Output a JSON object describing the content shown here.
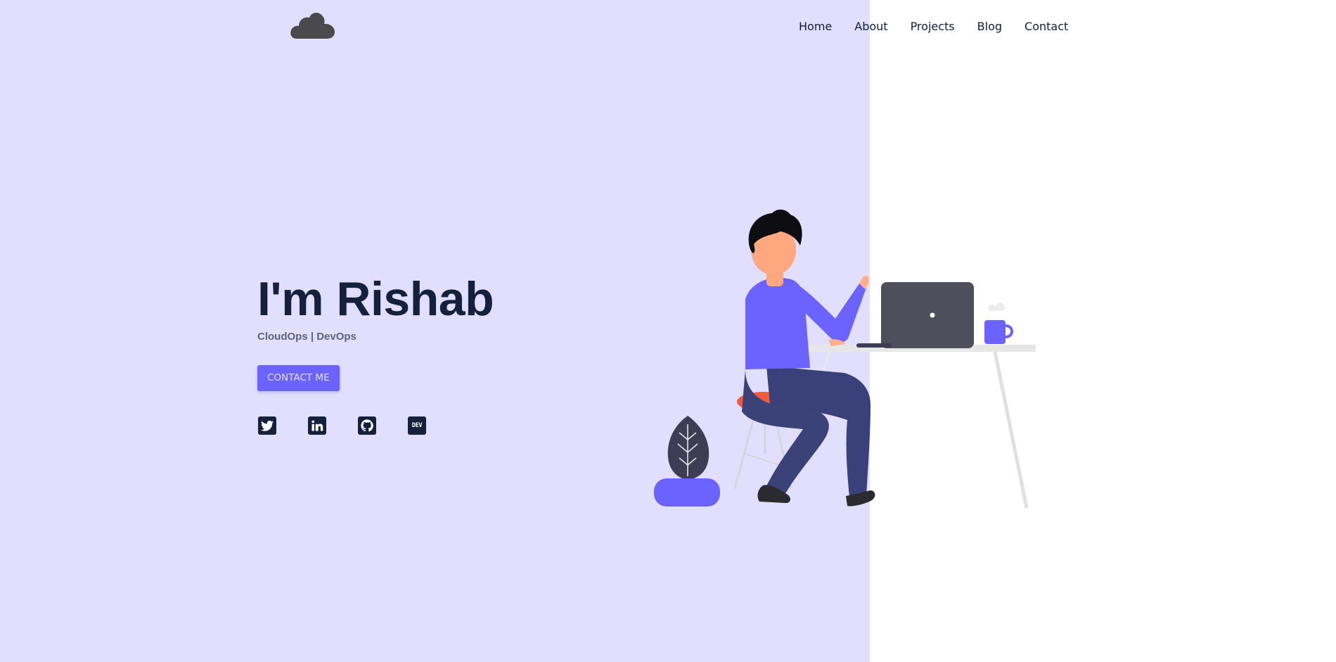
{
  "colors": {
    "left_background": "#e2dffe",
    "accent": "#6c63ff",
    "heading": "#14213d",
    "subtext": "#5b6478"
  },
  "header": {
    "logo_icon": "cloud-icon",
    "nav": [
      "Home",
      "About",
      "Projects",
      "Blog",
      "Contact"
    ]
  },
  "hero": {
    "title": "I'm Rishab",
    "subtitle": "CloudOps | DevOps",
    "cta_label": "CONTACT ME"
  },
  "socials": [
    {
      "icon": "twitter-icon"
    },
    {
      "icon": "linkedin-icon"
    },
    {
      "icon": "github-icon"
    },
    {
      "icon": "dev-icon",
      "label": "DEV"
    }
  ]
}
